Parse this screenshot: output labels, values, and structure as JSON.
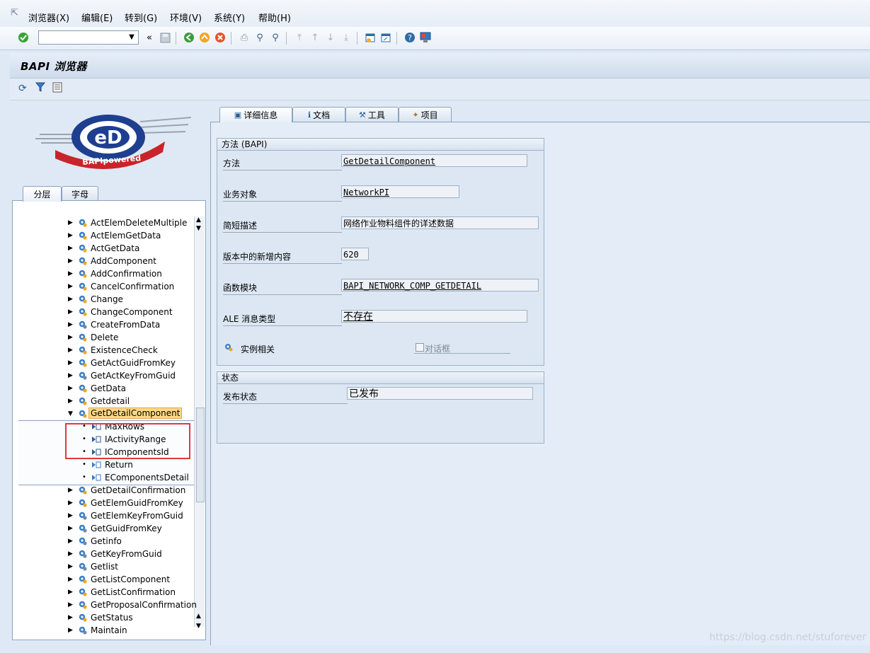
{
  "menu": [
    "浏览器(X)",
    "编辑(E)",
    "转到(G)",
    "环境(V)",
    "系统(Y)",
    "帮助(H)"
  ],
  "toolbar": {
    "command_value": ""
  },
  "title": "BAPI 浏览器",
  "left_tabs": [
    "分层",
    "字母"
  ],
  "logo_text": "BAPIpowered",
  "tree_rows": [
    {
      "label": "ActElemDeleteMultiple",
      "icon": "gear-icon"
    },
    {
      "label": "ActElemGetData",
      "icon": "gear-icon"
    },
    {
      "label": "ActGetData",
      "icon": "gear-icon"
    },
    {
      "label": "AddComponent",
      "icon": "gear-icon"
    },
    {
      "label": "AddConfirmation",
      "icon": "gear-icon"
    },
    {
      "label": "CancelConfirmation",
      "icon": "gear-icon"
    },
    {
      "label": "Change",
      "icon": "gear-icon"
    },
    {
      "label": "ChangeComponent",
      "icon": "gear-icon"
    },
    {
      "label": "CreateFromData",
      "icon": "gear-cycle-icon"
    },
    {
      "label": "Delete",
      "icon": "gear-icon"
    },
    {
      "label": "ExistenceCheck",
      "icon": "gear-icon"
    },
    {
      "label": "GetActGuidFromKey",
      "icon": "gear-icon"
    },
    {
      "label": "GetActKeyFromGuid",
      "icon": "gear-cycle-icon"
    },
    {
      "label": "GetData",
      "icon": "gear-icon"
    },
    {
      "label": "Getdetail",
      "icon": "gear-icon"
    },
    {
      "label": "GetDetailComponent",
      "icon": "gear-icon",
      "expanded": true,
      "selected": true
    }
  ],
  "tree_children": [
    {
      "label": "MaxRows",
      "icon": "import-param-icon"
    },
    {
      "label": "IActivityRange",
      "icon": "import-param-icon"
    },
    {
      "label": "IComponentsId",
      "icon": "import-param-icon"
    },
    {
      "label": "Return",
      "icon": "export-param-icon"
    },
    {
      "label": "EComponentsDetail",
      "icon": "export-param-icon"
    }
  ],
  "tree_rows_after": [
    {
      "label": "GetDetailConfirmation",
      "icon": "gear-icon"
    },
    {
      "label": "GetElemGuidFromKey",
      "icon": "gear-icon"
    },
    {
      "label": "GetElemKeyFromGuid",
      "icon": "gear-cycle-icon"
    },
    {
      "label": "GetGuidFromKey",
      "icon": "gear-cycle-icon"
    },
    {
      "label": "Getinfo",
      "icon": "gear-cycle-icon"
    },
    {
      "label": "GetKeyFromGuid",
      "icon": "gear-cycle-icon"
    },
    {
      "label": "Getlist",
      "icon": "gear-cycle-icon"
    },
    {
      "label": "GetListComponent",
      "icon": "gear-icon"
    },
    {
      "label": "GetListConfirmation",
      "icon": "gear-icon"
    },
    {
      "label": "GetProposalConfirmation",
      "icon": "gear-icon"
    },
    {
      "label": "GetStatus",
      "icon": "gear-icon"
    },
    {
      "label": "Maintain",
      "icon": "gear-cycle-icon"
    }
  ],
  "right_tabs": [
    {
      "label": "详细信息",
      "icon": "detail-icon"
    },
    {
      "label": "文档",
      "icon": "info-icon"
    },
    {
      "label": "工具",
      "icon": "tools-icon"
    },
    {
      "label": "项目",
      "icon": "wand-icon"
    }
  ],
  "method_group": {
    "title": "方法 (BAPI)",
    "fields": [
      {
        "label": "方法",
        "value": "GetDetailComponent"
      },
      {
        "label": "业务对象",
        "value": "NetworkPI"
      },
      {
        "label": "简短描述",
        "value": "网络作业物料组件的详述数据"
      },
      {
        "label": "版本中的新增内容",
        "value": "620"
      },
      {
        "label": "函数模块",
        "value": "BAPI_NETWORK_COMP_GETDETAIL"
      },
      {
        "label": "ALE 消息类型",
        "value": "不存在"
      }
    ],
    "instance_label": "实例相关",
    "dialog_label": "对话框"
  },
  "status_group": {
    "title": "状态",
    "release_label": "发布状态",
    "release_value": "已发布"
  },
  "watermark": "https://blog.csdn.net/stuforever"
}
